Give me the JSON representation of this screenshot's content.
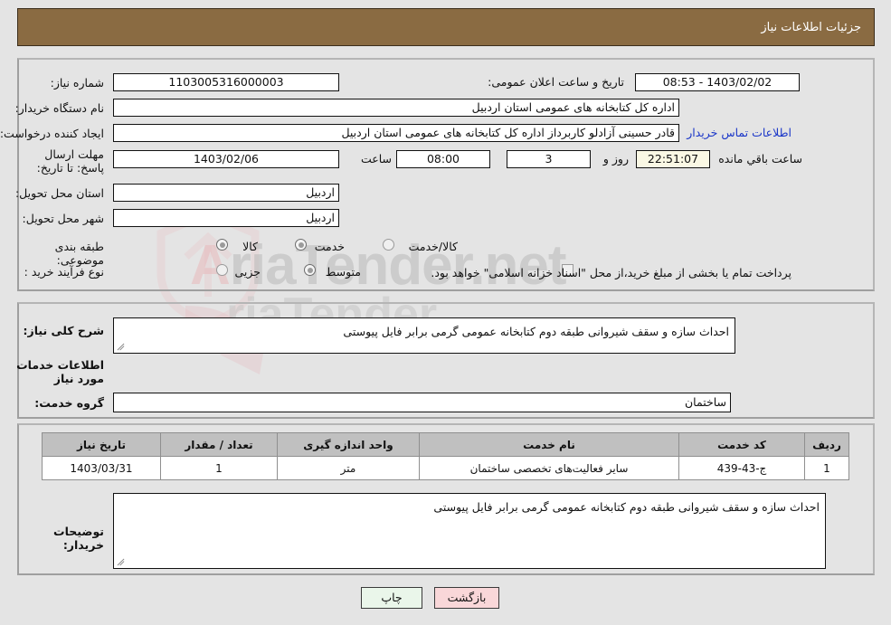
{
  "header": {
    "title": "جزئیات اطلاعات نیاز",
    "bg_color": "#8a6b42"
  },
  "top_panel": {
    "need_number": {
      "label": "شماره نیاز:",
      "value": "1103005316000003"
    },
    "announce": {
      "label": "تاریخ و ساعت اعلان عمومی:",
      "value": "1403/02/02 - 08:53"
    },
    "buyer_org": {
      "label": "نام دستگاه خریدار:",
      "value": "اداره کل کتابخانه های عمومی استان اردبیل"
    },
    "creator": {
      "label": "ایجاد کننده درخواست:",
      "value": "قادر حسینی آزادلو کاربرداز اداره کل کتابخانه های عمومی استان اردبیل"
    },
    "contact_link": "اطلاعات تماس خریدار",
    "deadline": {
      "label": "مهلت ارسال پاسخ: تا تاریخ:",
      "date": "1403/02/06",
      "time_label": "ساعت",
      "time": "08:00",
      "days": "3",
      "days_label": "روز و",
      "remaining": "22:51:07",
      "remaining_label": "ساعت باقي مانده"
    },
    "province": {
      "label": "استان محل تحویل:",
      "value": "اردبیل"
    },
    "city": {
      "label": "شهر محل تحویل:",
      "value": "اردبیل"
    },
    "category": {
      "label": "طبقه بندی موضوعی:",
      "options": [
        "کالا",
        "خدمت",
        "کالا/خدمت"
      ],
      "selected": "خدمت"
    },
    "process_type": {
      "label": "نوع فرآیند خرید :",
      "options": [
        "جزیی",
        "متوسط"
      ],
      "selected": "متوسط",
      "note": "پرداخت تمام یا بخشی از مبلغ خرید،از محل \"اسناد خزانه اسلامی\" خواهد بود."
    }
  },
  "middle_panel": {
    "general_desc": {
      "label": "شرح کلی نیاز:",
      "value": "احداث سازه و سقف شیروانی طبقه دوم کتابخانه عمومی گرمی برابر فایل پیوستی"
    },
    "section_title": "اطلاعات خدمات مورد نیاز",
    "service_group": {
      "label": "گروه خدمت:",
      "value": "ساختمان"
    }
  },
  "table": {
    "columns": [
      "ردیف",
      "کد خدمت",
      "نام خدمت",
      "واحد اندازه گیری",
      "تعداد / مقدار",
      "تاریخ نیاز"
    ],
    "rows": [
      {
        "row": "1",
        "code": "ج-43-439",
        "name": "سایر فعالیت‌های تخصصی ساختمان",
        "unit": "متر",
        "qty": "1",
        "date": "1403/03/31"
      }
    ]
  },
  "bottom_panel": {
    "buyer_notes": {
      "label": "توضیحات خریدار:",
      "value": "احداث سازه و سقف شیروانی طبقه دوم کتابخانه عمومی گرمی برابر فایل پیوستی"
    }
  },
  "footer": {
    "back_button": "بازگشت",
    "print_button": "چاپ"
  },
  "watermark": {
    "text_left": "A",
    "text_main": "riaTender.net"
  }
}
